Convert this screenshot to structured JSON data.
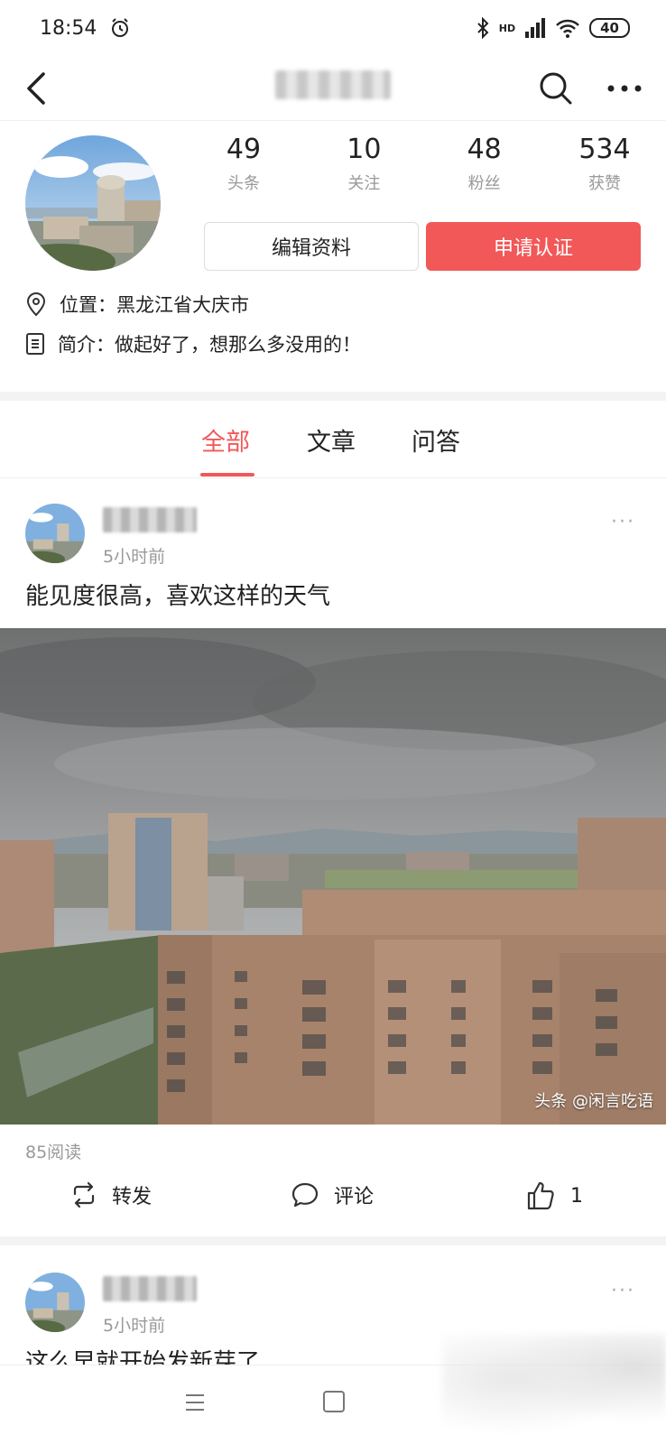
{
  "status_bar": {
    "time": "18:54",
    "network": "HD",
    "battery": "40"
  },
  "nav": {
    "back_icon": "chevron-left-icon",
    "search_icon": "search-icon",
    "more_icon": "more-horizontal-icon"
  },
  "profile": {
    "stats": [
      {
        "value": "49",
        "label": "头条"
      },
      {
        "value": "10",
        "label": "关注"
      },
      {
        "value": "48",
        "label": "粉丝"
      },
      {
        "value": "534",
        "label": "获赞"
      }
    ],
    "edit_button": "编辑资料",
    "verify_button": "申请认证",
    "location_label": "位置：黑龙江省大庆市",
    "bio_label": "简介：做起好了，想那么多没用的！"
  },
  "tabs": [
    {
      "label": "全部",
      "active": true
    },
    {
      "label": "文章",
      "active": false
    },
    {
      "label": "问答",
      "active": false
    }
  ],
  "posts": [
    {
      "time": "5小时前",
      "text": "能见度很高，喜欢这样的天气",
      "image_watermark": "头条 @闲言吃语",
      "reads": "85阅读",
      "actions": {
        "repost": "转发",
        "comment": "评论",
        "likes": "1"
      }
    },
    {
      "time": "5小时前",
      "text": "这么早就开始发新芽了"
    }
  ],
  "colors": {
    "accent": "#f25858",
    "muted": "#999999",
    "text": "#222222"
  }
}
